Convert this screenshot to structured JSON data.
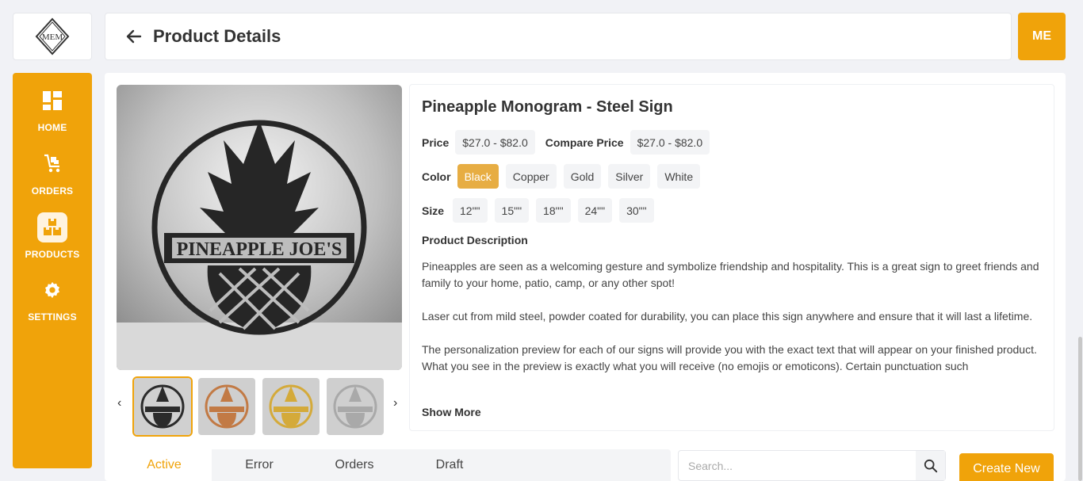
{
  "brand": {
    "logo_text": "MEM",
    "accent": "#f0a30a"
  },
  "header": {
    "title": "Product Details",
    "back_icon": "arrow-left-icon"
  },
  "user": {
    "initials": "ME"
  },
  "sidebar": {
    "items": [
      {
        "label": "HOME",
        "icon": "dashboard-icon",
        "active": false
      },
      {
        "label": "ORDERS",
        "icon": "cart-icon",
        "active": false
      },
      {
        "label": "PRODUCTS",
        "icon": "boxes-icon",
        "active": true
      },
      {
        "label": "SETTINGS",
        "icon": "gear-icon",
        "active": false
      }
    ]
  },
  "gallery": {
    "hero_text": "PINEAPPLE JOE'S",
    "thumbnails": [
      {
        "variant": "Black",
        "color": "#2b2b2b"
      },
      {
        "variant": "Copper",
        "color": "#c27a45"
      },
      {
        "variant": "Gold",
        "color": "#d4aa3a"
      },
      {
        "variant": "Silver",
        "color": "#a9a9a9"
      }
    ],
    "prev": "‹",
    "next": "›"
  },
  "product": {
    "title": "Pineapple Monogram - Steel Sign",
    "price_label": "Price",
    "price": "$27.0 - $82.0",
    "compare_label": "Compare Price",
    "compare_price": "$27.0 - $82.0",
    "color_label": "Color",
    "colors": [
      "Black",
      "Copper",
      "Gold",
      "Silver",
      "White"
    ],
    "selected_color": "Black",
    "size_label": "Size",
    "sizes": [
      "12\"\"",
      "15\"\"",
      "18\"\"",
      "24\"\"",
      "30\"\""
    ],
    "description_heading": "Product Description",
    "description": [
      "Pineapples are seen as a welcoming gesture and symbolize friendship and hospitality. This is a great sign to greet friends and family to your home, patio, camp, or any other spot!",
      "Laser cut from mild steel, powder coated for durability, you can place this sign anywhere and ensure that it will last a lifetime.",
      "The personalization preview for each of our signs will provide you with the exact text that will appear on your finished product. What you see in the preview is exactly what you will receive (no emojis or emoticons). Certain punctuation such"
    ],
    "show_more": "Show More"
  },
  "tabs": [
    {
      "label": "Active",
      "active": true
    },
    {
      "label": "Error",
      "active": false
    },
    {
      "label": "Orders",
      "active": false
    },
    {
      "label": "Draft",
      "active": false
    }
  ],
  "search": {
    "placeholder": "Search..."
  },
  "actions": {
    "create_label": "Create New"
  }
}
